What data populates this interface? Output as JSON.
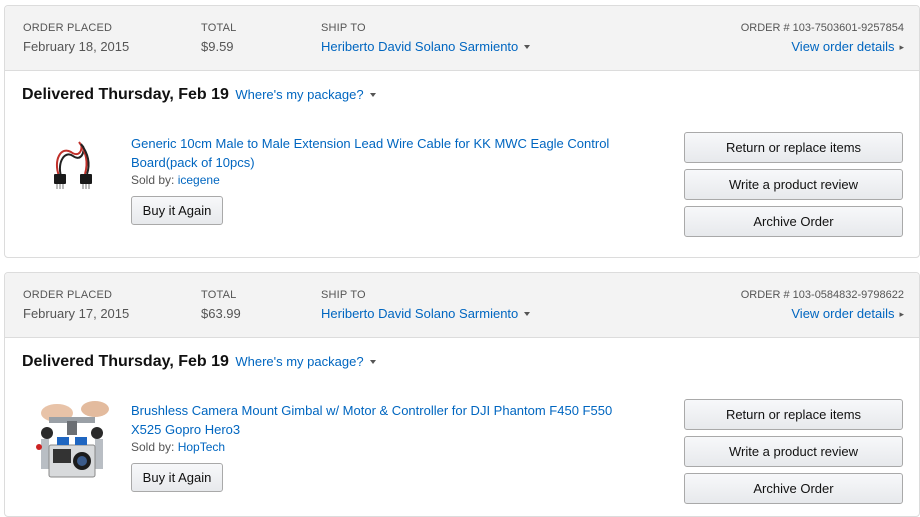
{
  "orders": [
    {
      "order_placed_label": "ORDER PLACED",
      "order_placed": "February 18, 2015",
      "total_label": "TOTAL",
      "total": "$9.59",
      "ship_to_label": "SHIP TO",
      "ship_to": "Heriberto David Solano Sarmiento",
      "order_number": "ORDER # 103-7503601-9257854",
      "view_details": "View order details",
      "delivery": "Delivered Thursday, Feb 19",
      "wheres_package": "Where's my package?",
      "product_title": "Generic 10cm Male to Male Extension Lead Wire Cable for KK MWC Eagle Control Board(pack of 10pcs)",
      "sold_by_label": "Sold by:",
      "seller": "icegene",
      "buy_again": "Buy it Again",
      "return_btn": "Return or replace items",
      "review_btn": "Write a product review",
      "archive_btn": "Archive Order"
    },
    {
      "order_placed_label": "ORDER PLACED",
      "order_placed": "February 17, 2015",
      "total_label": "TOTAL",
      "total": "$63.99",
      "ship_to_label": "SHIP TO",
      "ship_to": "Heriberto David Solano Sarmiento",
      "order_number": "ORDER # 103-0584832-9798622",
      "view_details": "View order details",
      "delivery": "Delivered Thursday, Feb 19",
      "wheres_package": "Where's my package?",
      "product_title": "Brushless Camera Mount Gimbal w/ Motor & Controller for DJI Phantom F450 F550 X525 Gopro Hero3",
      "sold_by_label": "Sold by:",
      "seller": "HopTech",
      "buy_again": "Buy it Again",
      "return_btn": "Return or replace items",
      "review_btn": "Write a product review",
      "archive_btn": "Archive Order"
    }
  ],
  "colors": {
    "link": "#0066c0",
    "header_bg": "#f3f3f3",
    "border": "#dcdcdc"
  },
  "icons": [
    "chevron-down-icon",
    "chevron-right-icon",
    "wire-cable-product-image",
    "gimbal-product-image"
  ]
}
